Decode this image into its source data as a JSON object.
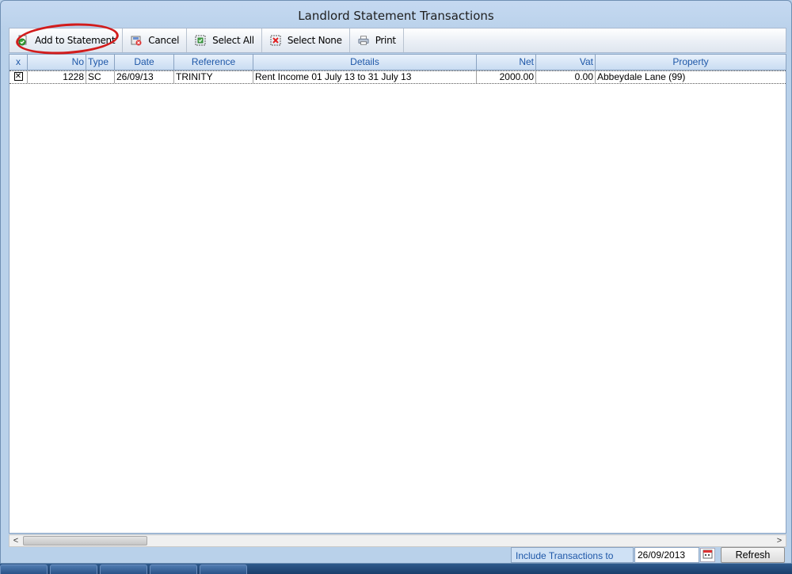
{
  "window": {
    "title": "Landlord Statement Transactions"
  },
  "toolbar": {
    "add_label": "Add to Statement",
    "cancel_label": "Cancel",
    "select_all_label": "Select All",
    "select_none_label": "Select None",
    "print_label": "Print"
  },
  "grid": {
    "columns": [
      "x",
      "No",
      "Type",
      "Date",
      "Reference",
      "Details",
      "Net",
      "Vat",
      "Property"
    ],
    "rows": [
      {
        "checked": "✕",
        "no": "1228",
        "type": "SC",
        "date": "26/09/13",
        "reference": "TRINITY",
        "details": "Rent Income 01 July 13 to 31 July 13",
        "net": "2000.00",
        "vat": "0.00",
        "property": "Abbeydale Lane (99)"
      }
    ]
  },
  "footer": {
    "include_label": "Include Transactions to",
    "date_value": "26/09/2013",
    "refresh_label": "Refresh"
  },
  "scrollbar": {
    "left_arrow": "<",
    "right_arrow": ">"
  },
  "colors": {
    "header_text": "#1e57a8",
    "annotation": "#d21c1c"
  }
}
